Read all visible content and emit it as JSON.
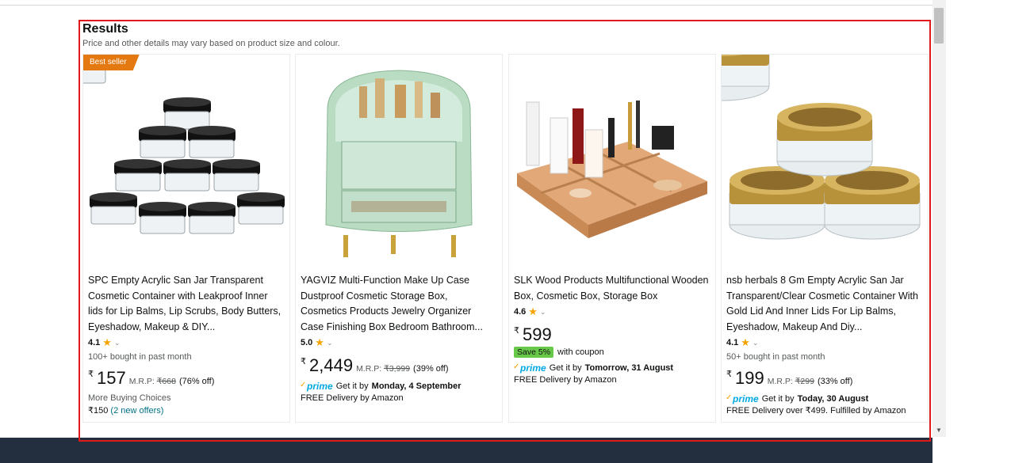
{
  "results": {
    "title": "Results",
    "subtitle": "Price and other details may vary based on product size and colour."
  },
  "products": [
    {
      "badge": "Best seller",
      "title": "SPC Empty Acrylic San Jar Transparent Cosmetic Container with Leakproof Inner lids for Lip Balms, Lip Scrubs, Body Butters, Eyeshadow, Makeup & DIY...",
      "rating": "4.1",
      "bought": "100+ bought in past month",
      "currency": "₹",
      "price": "157",
      "mrp_label": "M.R.P:",
      "mrp": "₹668",
      "discount": "(76% off)",
      "more_choices": "More Buying Choices",
      "offer_price": "₹150",
      "offers_link": "(2 new offers)"
    },
    {
      "title": "YAGVIZ Multi-Function Make Up Case Dustproof Cosmetic Storage Box, Cosmetics Products Jewelry Organizer Case Finishing Box Bedroom Bathroom...",
      "rating": "5.0",
      "currency": "₹",
      "price": "2,449",
      "mrp_label": "M.R.P:",
      "mrp": "₹3,999",
      "discount": "(39% off)",
      "prime": "prime",
      "delivery_prefix": "Get it by",
      "delivery_date": "Monday, 4 September",
      "delivery_note": "FREE Delivery by Amazon"
    },
    {
      "title": "SLK Wood Products Multifunctional Wooden Box, Cosmetic Box, Storage Box",
      "rating": "4.6",
      "currency": "₹",
      "price": "599",
      "save_badge": "Save 5%",
      "coupon_text": "with coupon",
      "prime": "prime",
      "delivery_prefix": "Get it by",
      "delivery_date": "Tomorrow, 31 August",
      "delivery_note": "FREE Delivery by Amazon"
    },
    {
      "title": "nsb herbals 8 Gm Empty Acrylic San Jar Transparent/Clear Cosmetic Container With Gold Lid And Inner Lids For Lip Balms, Eyeshadow, Makeup And Diy...",
      "rating": "4.1",
      "bought": "50+ bought in past month",
      "currency": "₹",
      "price": "199",
      "mrp_label": "M.R.P:",
      "mrp": "₹299",
      "discount": "(33% off)",
      "prime": "prime",
      "delivery_prefix": "Get it by",
      "delivery_date": "Today, 30 August",
      "delivery_note": "FREE Delivery over ₹499. Fulfilled by Amazon"
    }
  ],
  "icons": {
    "star": "★",
    "chevron": "⌄",
    "check": "✓"
  },
  "colors": {
    "badge": "#e47911",
    "star": "#f5a300",
    "prime": "#00a8e1",
    "link": "#007185",
    "save": "#68c84a",
    "highlight": "#e01a1a"
  }
}
